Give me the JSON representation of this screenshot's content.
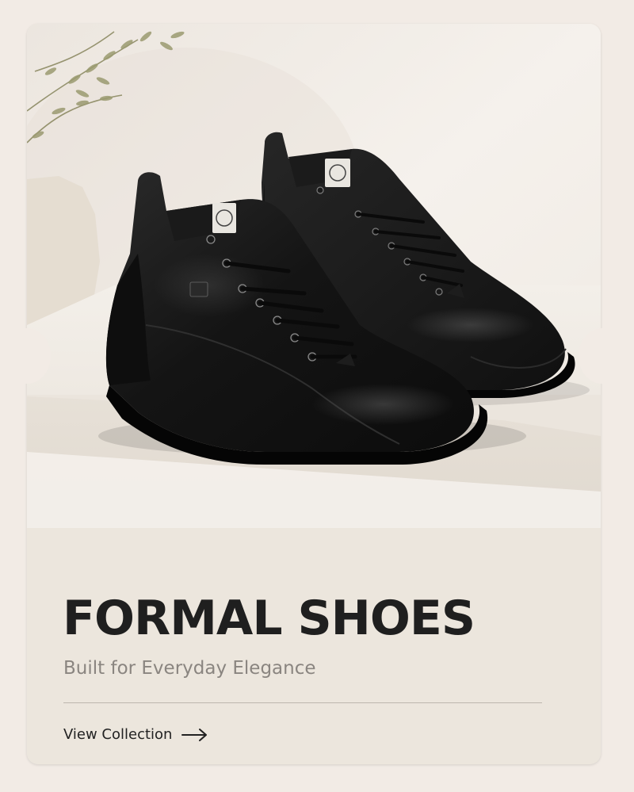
{
  "hero": {
    "title": "FORMAL SHOES",
    "subtitle": "Built for Everyday Elegance",
    "cta_label": "View Collection",
    "cta_icon": "arrow-right-icon",
    "image_subject": "black leather lace-up ankle boots",
    "colors": {
      "page_background": "#f2ebe5",
      "card_background": "#ece6dd",
      "title_color": "#1f1f1f",
      "subtitle_color": "#8a8580",
      "divider_color": "#bdb6ae"
    }
  }
}
